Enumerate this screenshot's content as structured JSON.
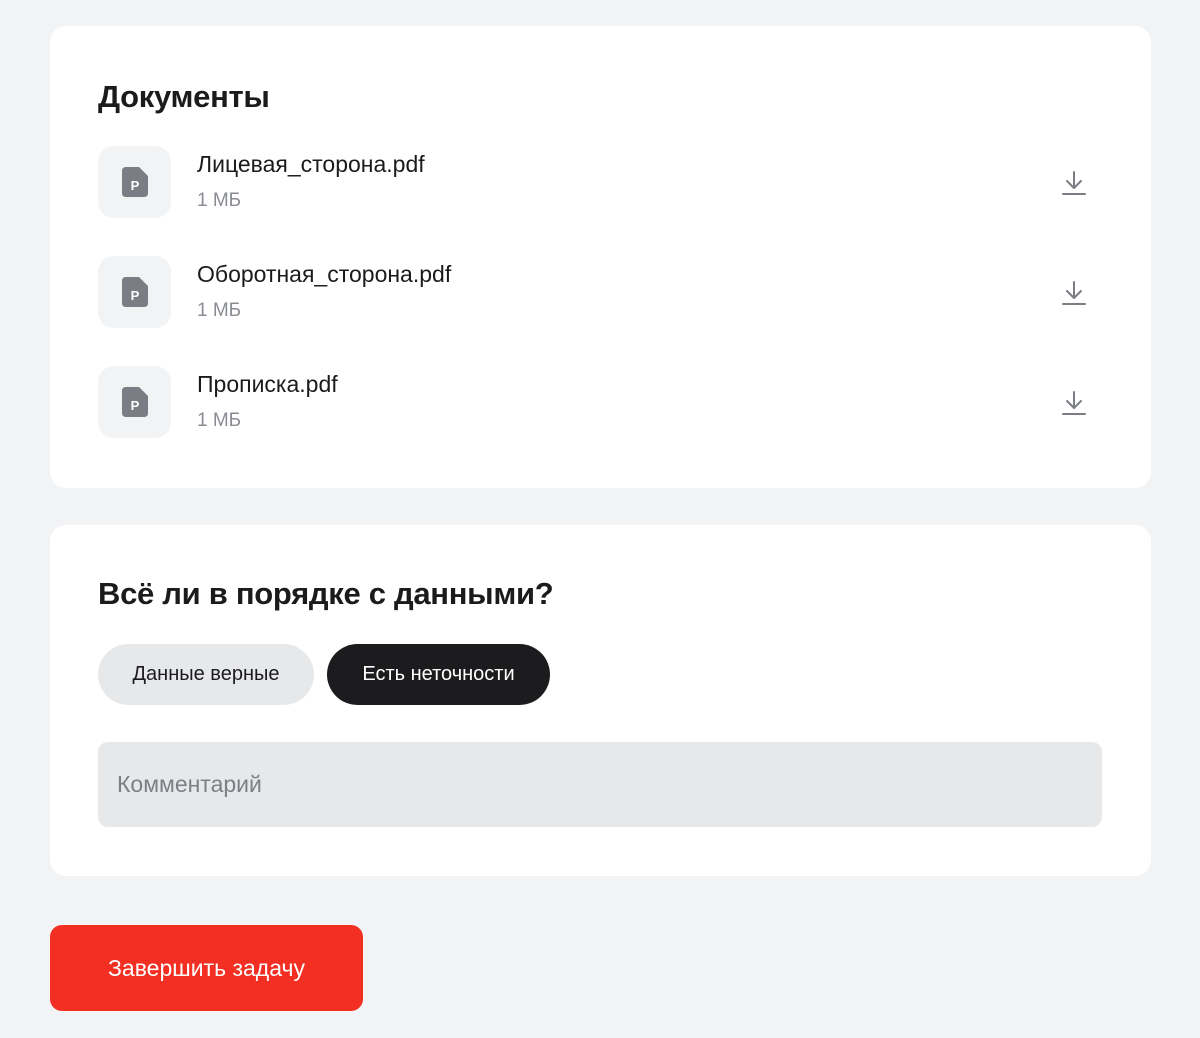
{
  "documents": {
    "title": "Документы",
    "items": [
      {
        "name": "Лицевая_сторона.pdf",
        "size": "1 МБ",
        "icon": "pdf-file-icon"
      },
      {
        "name": "Оборотная_сторона.pdf",
        "size": "1 МБ",
        "icon": "pdf-file-icon"
      },
      {
        "name": "Прописка.pdf",
        "size": "1 МБ",
        "icon": "pdf-file-icon"
      }
    ],
    "download_icon": "download-icon"
  },
  "check": {
    "title": "Всё ли в порядке с данными?",
    "options": [
      {
        "label": "Данные верные",
        "selected": false
      },
      {
        "label": "Есть неточности",
        "selected": true
      }
    ],
    "comment": {
      "value": "",
      "placeholder": "Комментарий"
    }
  },
  "submit": {
    "label": "Завершить задачу"
  },
  "colors": {
    "background": "#f2f3f5",
    "card": "#ffffff",
    "chip_light": "#e7e8ea",
    "chip_dark": "#1c1c1e",
    "accent": "#f22f22",
    "secondary_text": "#8a8c93",
    "icon": "#7b7d84"
  }
}
